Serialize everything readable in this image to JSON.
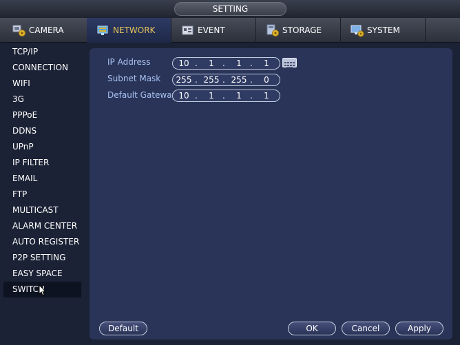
{
  "window": {
    "title": "SETTING"
  },
  "tabs": [
    {
      "label": "CAMERA",
      "icon": "camera-gear-icon"
    },
    {
      "label": "NETWORK",
      "icon": "network-icon"
    },
    {
      "label": "EVENT",
      "icon": "event-icon"
    },
    {
      "label": "STORAGE",
      "icon": "storage-icon"
    },
    {
      "label": "SYSTEM",
      "icon": "system-icon"
    }
  ],
  "active_tab": "NETWORK",
  "sidebar": {
    "items": [
      {
        "label": "TCP/IP"
      },
      {
        "label": "CONNECTION"
      },
      {
        "label": "WIFI"
      },
      {
        "label": "3G"
      },
      {
        "label": "PPPoE"
      },
      {
        "label": "DDNS"
      },
      {
        "label": "UPnP"
      },
      {
        "label": "IP FILTER"
      },
      {
        "label": "EMAIL"
      },
      {
        "label": "FTP"
      },
      {
        "label": "MULTICAST"
      },
      {
        "label": "ALARM CENTER"
      },
      {
        "label": "AUTO REGISTER"
      },
      {
        "label": "P2P SETTING"
      },
      {
        "label": "EASY SPACE"
      },
      {
        "label": "SWITCH"
      }
    ],
    "selected": "SWITCH"
  },
  "form": {
    "ip_address": {
      "label": "IP Address",
      "octets": [
        "10",
        "1",
        "1",
        "1"
      ]
    },
    "subnet_mask": {
      "label": "Subnet Mask",
      "octets": [
        "255",
        "255",
        "255",
        "0"
      ]
    },
    "default_gateway": {
      "label": "Default Gateway",
      "octets": [
        "10",
        "1",
        "1",
        "1"
      ]
    },
    "separator": "."
  },
  "buttons": {
    "default": "Default",
    "ok": "OK",
    "cancel": "Cancel",
    "apply": "Apply"
  },
  "colors": {
    "accent_text": "#e6c35a",
    "label_text": "#a9c1f1",
    "panel": "#293458",
    "background": "#1b2235"
  }
}
